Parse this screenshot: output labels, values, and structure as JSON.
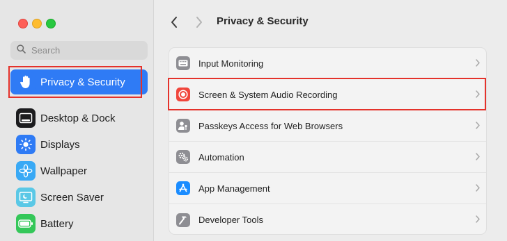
{
  "window": {
    "title": "Privacy & Security"
  },
  "search": {
    "placeholder": "Search"
  },
  "sidebar": {
    "items": [
      {
        "label": "Privacy & Security",
        "icon": "hand-icon",
        "selected": true
      },
      {
        "label": "Desktop & Dock",
        "icon": "dock-icon"
      },
      {
        "label": "Displays",
        "icon": "sun-icon"
      },
      {
        "label": "Wallpaper",
        "icon": "flower-icon"
      },
      {
        "label": "Screen Saver",
        "icon": "screensaver-icon"
      },
      {
        "label": "Battery",
        "icon": "battery-icon"
      }
    ]
  },
  "main": {
    "rows": [
      {
        "label": "Input Monitoring",
        "icon": "keyboard-icon"
      },
      {
        "label": "Screen & System Audio Recording",
        "icon": "record-icon"
      },
      {
        "label": "Passkeys Access for Web Browsers",
        "icon": "person-key-icon"
      },
      {
        "label": "Automation",
        "icon": "gears-icon"
      },
      {
        "label": "App Management",
        "icon": "app-store-icon"
      },
      {
        "label": "Developer Tools",
        "icon": "hammer-icon"
      }
    ]
  },
  "colors": {
    "accent": "#2f7bf5",
    "highlight": "#e4322b"
  }
}
